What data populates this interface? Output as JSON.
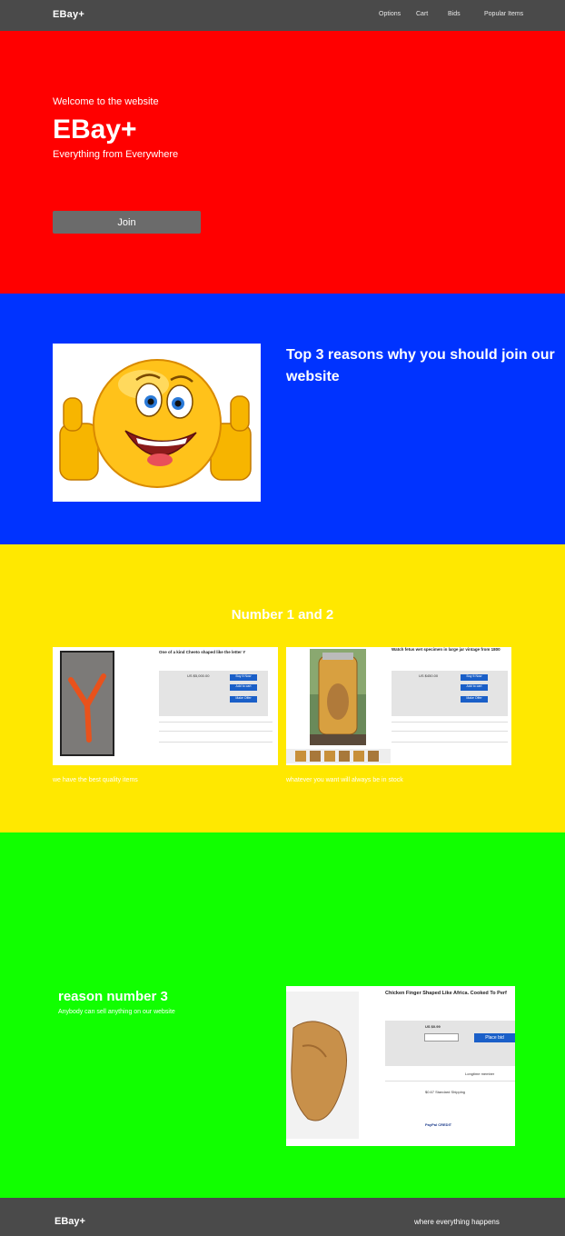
{
  "nav": {
    "brand": "EBay+",
    "links": [
      "Options",
      "Cart",
      "Bids",
      "Popular Items"
    ]
  },
  "hero": {
    "welcome": "Welcome to the website",
    "title": "EBay+",
    "tagline": "Everything from Everywhere",
    "join_label": "Join"
  },
  "reasons": {
    "heading": "Top 3 reasons why you should join our website",
    "image_icon": "thumbs-up-smiley-image"
  },
  "numbers": {
    "heading": "Number 1 and 2",
    "items": [
      {
        "caption": "we have the best quality items",
        "listing_title": "One of a kind Cheeto shaped like the letter Y",
        "price": "US $5,000.00",
        "buttons": [
          "Buy It Now",
          "Add to cart",
          "Make Offer"
        ]
      },
      {
        "caption": "whatever you want will always be in stock",
        "listing_title": "Watch fetus wet specimen in large jar vintage from 1800",
        "price": "US $450.00",
        "buttons": [
          "Buy It Now",
          "Add to cart",
          "Make Offer"
        ]
      }
    ]
  },
  "reason3": {
    "heading": "reason number 3",
    "sub": "Anybody can sell anything on our website",
    "listing_title": "Chicken Finger Shaped Like Africa. Cooked To Perf",
    "price": "US $0.99",
    "bid_button": "Place bid",
    "member_label": "Longtime member",
    "shipping": "$0.67 Standard Shipping",
    "paypal": "PayPal CREDIT"
  },
  "footer": {
    "brand": "EBay+",
    "tagline": "where everything happens"
  },
  "colors": {
    "nav": "#4a4a4a",
    "hero": "#ff0000",
    "blue": "#0033ff",
    "yellow": "#ffe800",
    "green": "#11ff00"
  }
}
